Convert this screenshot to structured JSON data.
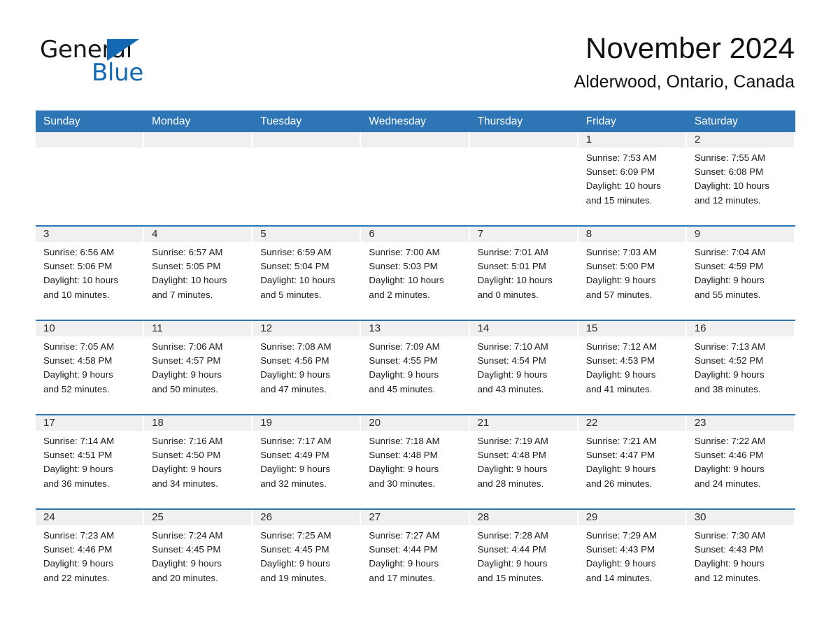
{
  "brand": {
    "name_part1": "General",
    "name_part2": "Blue",
    "accent_color": "#1268b3",
    "triangle_icon": "triangle-logo-icon"
  },
  "header": {
    "month_title": "November 2024",
    "location": "Alderwood, Ontario, Canada"
  },
  "calendar": {
    "header_color": "#2e75b6",
    "weekdays": [
      "Sunday",
      "Monday",
      "Tuesday",
      "Wednesday",
      "Thursday",
      "Friday",
      "Saturday"
    ],
    "weeks": [
      [
        {
          "day": "",
          "empty": true
        },
        {
          "day": "",
          "empty": true
        },
        {
          "day": "",
          "empty": true
        },
        {
          "day": "",
          "empty": true
        },
        {
          "day": "",
          "empty": true
        },
        {
          "day": "1",
          "sunrise": "Sunrise: 7:53 AM",
          "sunset": "Sunset: 6:09 PM",
          "daylight_line1": "Daylight: 10 hours",
          "daylight_line2": "and 15 minutes."
        },
        {
          "day": "2",
          "sunrise": "Sunrise: 7:55 AM",
          "sunset": "Sunset: 6:08 PM",
          "daylight_line1": "Daylight: 10 hours",
          "daylight_line2": "and 12 minutes."
        }
      ],
      [
        {
          "day": "3",
          "sunrise": "Sunrise: 6:56 AM",
          "sunset": "Sunset: 5:06 PM",
          "daylight_line1": "Daylight: 10 hours",
          "daylight_line2": "and 10 minutes."
        },
        {
          "day": "4",
          "sunrise": "Sunrise: 6:57 AM",
          "sunset": "Sunset: 5:05 PM",
          "daylight_line1": "Daylight: 10 hours",
          "daylight_line2": "and 7 minutes."
        },
        {
          "day": "5",
          "sunrise": "Sunrise: 6:59 AM",
          "sunset": "Sunset: 5:04 PM",
          "daylight_line1": "Daylight: 10 hours",
          "daylight_line2": "and 5 minutes."
        },
        {
          "day": "6",
          "sunrise": "Sunrise: 7:00 AM",
          "sunset": "Sunset: 5:03 PM",
          "daylight_line1": "Daylight: 10 hours",
          "daylight_line2": "and 2 minutes."
        },
        {
          "day": "7",
          "sunrise": "Sunrise: 7:01 AM",
          "sunset": "Sunset: 5:01 PM",
          "daylight_line1": "Daylight: 10 hours",
          "daylight_line2": "and 0 minutes."
        },
        {
          "day": "8",
          "sunrise": "Sunrise: 7:03 AM",
          "sunset": "Sunset: 5:00 PM",
          "daylight_line1": "Daylight: 9 hours",
          "daylight_line2": "and 57 minutes."
        },
        {
          "day": "9",
          "sunrise": "Sunrise: 7:04 AM",
          "sunset": "Sunset: 4:59 PM",
          "daylight_line1": "Daylight: 9 hours",
          "daylight_line2": "and 55 minutes."
        }
      ],
      [
        {
          "day": "10",
          "sunrise": "Sunrise: 7:05 AM",
          "sunset": "Sunset: 4:58 PM",
          "daylight_line1": "Daylight: 9 hours",
          "daylight_line2": "and 52 minutes."
        },
        {
          "day": "11",
          "sunrise": "Sunrise: 7:06 AM",
          "sunset": "Sunset: 4:57 PM",
          "daylight_line1": "Daylight: 9 hours",
          "daylight_line2": "and 50 minutes."
        },
        {
          "day": "12",
          "sunrise": "Sunrise: 7:08 AM",
          "sunset": "Sunset: 4:56 PM",
          "daylight_line1": "Daylight: 9 hours",
          "daylight_line2": "and 47 minutes."
        },
        {
          "day": "13",
          "sunrise": "Sunrise: 7:09 AM",
          "sunset": "Sunset: 4:55 PM",
          "daylight_line1": "Daylight: 9 hours",
          "daylight_line2": "and 45 minutes."
        },
        {
          "day": "14",
          "sunrise": "Sunrise: 7:10 AM",
          "sunset": "Sunset: 4:54 PM",
          "daylight_line1": "Daylight: 9 hours",
          "daylight_line2": "and 43 minutes."
        },
        {
          "day": "15",
          "sunrise": "Sunrise: 7:12 AM",
          "sunset": "Sunset: 4:53 PM",
          "daylight_line1": "Daylight: 9 hours",
          "daylight_line2": "and 41 minutes."
        },
        {
          "day": "16",
          "sunrise": "Sunrise: 7:13 AM",
          "sunset": "Sunset: 4:52 PM",
          "daylight_line1": "Daylight: 9 hours",
          "daylight_line2": "and 38 minutes."
        }
      ],
      [
        {
          "day": "17",
          "sunrise": "Sunrise: 7:14 AM",
          "sunset": "Sunset: 4:51 PM",
          "daylight_line1": "Daylight: 9 hours",
          "daylight_line2": "and 36 minutes."
        },
        {
          "day": "18",
          "sunrise": "Sunrise: 7:16 AM",
          "sunset": "Sunset: 4:50 PM",
          "daylight_line1": "Daylight: 9 hours",
          "daylight_line2": "and 34 minutes."
        },
        {
          "day": "19",
          "sunrise": "Sunrise: 7:17 AM",
          "sunset": "Sunset: 4:49 PM",
          "daylight_line1": "Daylight: 9 hours",
          "daylight_line2": "and 32 minutes."
        },
        {
          "day": "20",
          "sunrise": "Sunrise: 7:18 AM",
          "sunset": "Sunset: 4:48 PM",
          "daylight_line1": "Daylight: 9 hours",
          "daylight_line2": "and 30 minutes."
        },
        {
          "day": "21",
          "sunrise": "Sunrise: 7:19 AM",
          "sunset": "Sunset: 4:48 PM",
          "daylight_line1": "Daylight: 9 hours",
          "daylight_line2": "and 28 minutes."
        },
        {
          "day": "22",
          "sunrise": "Sunrise: 7:21 AM",
          "sunset": "Sunset: 4:47 PM",
          "daylight_line1": "Daylight: 9 hours",
          "daylight_line2": "and 26 minutes."
        },
        {
          "day": "23",
          "sunrise": "Sunrise: 7:22 AM",
          "sunset": "Sunset: 4:46 PM",
          "daylight_line1": "Daylight: 9 hours",
          "daylight_line2": "and 24 minutes."
        }
      ],
      [
        {
          "day": "24",
          "sunrise": "Sunrise: 7:23 AM",
          "sunset": "Sunset: 4:46 PM",
          "daylight_line1": "Daylight: 9 hours",
          "daylight_line2": "and 22 minutes."
        },
        {
          "day": "25",
          "sunrise": "Sunrise: 7:24 AM",
          "sunset": "Sunset: 4:45 PM",
          "daylight_line1": "Daylight: 9 hours",
          "daylight_line2": "and 20 minutes."
        },
        {
          "day": "26",
          "sunrise": "Sunrise: 7:25 AM",
          "sunset": "Sunset: 4:45 PM",
          "daylight_line1": "Daylight: 9 hours",
          "daylight_line2": "and 19 minutes."
        },
        {
          "day": "27",
          "sunrise": "Sunrise: 7:27 AM",
          "sunset": "Sunset: 4:44 PM",
          "daylight_line1": "Daylight: 9 hours",
          "daylight_line2": "and 17 minutes."
        },
        {
          "day": "28",
          "sunrise": "Sunrise: 7:28 AM",
          "sunset": "Sunset: 4:44 PM",
          "daylight_line1": "Daylight: 9 hours",
          "daylight_line2": "and 15 minutes."
        },
        {
          "day": "29",
          "sunrise": "Sunrise: 7:29 AM",
          "sunset": "Sunset: 4:43 PM",
          "daylight_line1": "Daylight: 9 hours",
          "daylight_line2": "and 14 minutes."
        },
        {
          "day": "30",
          "sunrise": "Sunrise: 7:30 AM",
          "sunset": "Sunset: 4:43 PM",
          "daylight_line1": "Daylight: 9 hours",
          "daylight_line2": "and 12 minutes."
        }
      ]
    ]
  }
}
